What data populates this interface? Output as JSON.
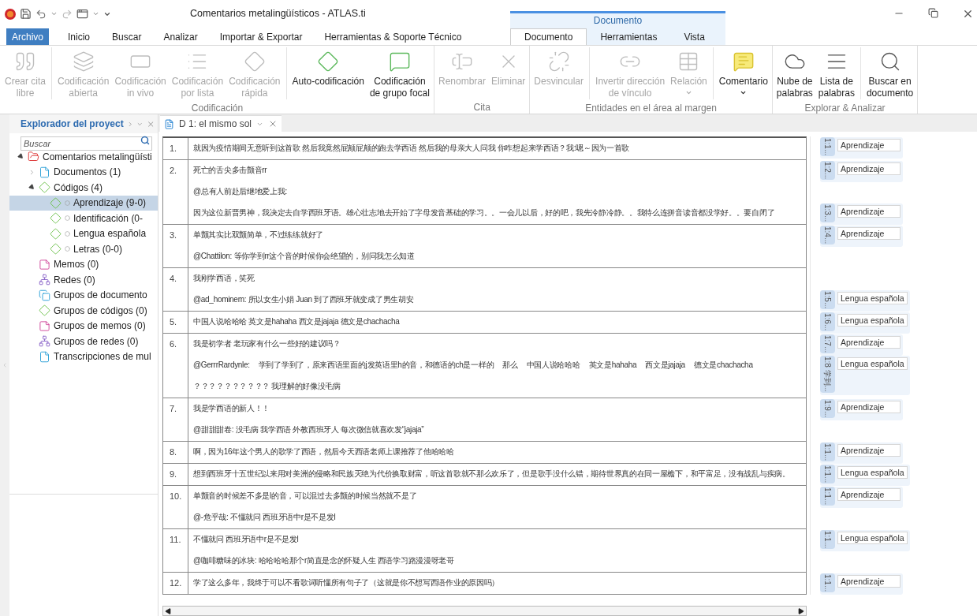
{
  "window": {
    "title": "Comentarios metalingüísticos - ATLAS.ti"
  },
  "menu_tabs": [
    {
      "label": "Archivo",
      "kind": "file",
      "selected": false
    },
    {
      "label": "Inicio",
      "kind": "main",
      "selected": false
    },
    {
      "label": "Buscar",
      "kind": "main",
      "selected": false
    },
    {
      "label": "Analizar",
      "kind": "main",
      "selected": false
    },
    {
      "label": "Importar & Exportar",
      "kind": "main",
      "selected": false
    },
    {
      "label": "Herramientas & Soporte Técnico",
      "kind": "main",
      "selected": false
    }
  ],
  "context_group": {
    "title": "Documento",
    "tabs": [
      {
        "label": "Documento",
        "selected": true
      },
      {
        "label": "Herramientas",
        "selected": false
      },
      {
        "label": "Vista",
        "selected": false
      }
    ]
  },
  "ribbon_groups": [
    {
      "caption": "Codificación",
      "sections": [
        [
          {
            "lines": [
              "Crear cita",
              "libre"
            ],
            "disabled": true
          }
        ],
        [
          {
            "lines": [
              "Codificación",
              "abierta"
            ],
            "disabled": true
          },
          {
            "lines": [
              "Codificación",
              "in vivo"
            ],
            "disabled": true
          },
          {
            "lines": [
              "Codificación",
              "por lista"
            ],
            "disabled": true
          },
          {
            "lines": [
              "Codificación",
              "rápida"
            ],
            "disabled": true
          }
        ],
        [
          {
            "lines": [
              "Auto-codificación"
            ],
            "disabled": false
          },
          {
            "lines": [
              "Codificación",
              "de grupo focal"
            ],
            "disabled": false
          }
        ]
      ]
    },
    {
      "caption": "Cita",
      "sections": [
        [
          {
            "lines": [
              "Renombrar"
            ],
            "disabled": true
          },
          {
            "lines": [
              "Eliminar"
            ],
            "disabled": true
          }
        ]
      ]
    },
    {
      "caption": "Entidades en el área al margen",
      "sections": [
        [
          {
            "lines": [
              "Desvincular"
            ],
            "disabled": true
          }
        ],
        [
          {
            "lines": [
              "Invertir dirección",
              "de vínculo"
            ],
            "disabled": true
          },
          {
            "lines": [
              "Relación"
            ],
            "disabled": true,
            "dropdown": true
          }
        ],
        [
          {
            "lines": [
              "Comentario"
            ],
            "disabled": false,
            "dropdown": true
          }
        ]
      ]
    },
    {
      "caption": "Explorar & Analizar",
      "sections": [
        [
          {
            "lines": [
              "Nube de",
              "palabras"
            ],
            "disabled": false
          },
          {
            "lines": [
              "Lista de",
              "palabras"
            ],
            "disabled": false
          }
        ],
        [
          {
            "lines": [
              "Buscar en",
              "documento"
            ],
            "disabled": false
          }
        ]
      ]
    }
  ],
  "explorer": {
    "title": "Explorador del proyect",
    "search": {
      "placeholder": "Buscar"
    },
    "tree": [
      {
        "label": "Comentarios metalingüísti",
        "kind": "project",
        "expanded": true,
        "selected": false,
        "children": [
          {
            "label": "Documentos (1)",
            "kind": "documents",
            "expanded": false,
            "selected": false
          },
          {
            "label": "Códigos (4)",
            "kind": "codes",
            "expanded": true,
            "selected": false,
            "children": [
              {
                "label": "Aprendizaje (9-0)",
                "kind": "code",
                "selected": true
              },
              {
                "label": "Identificación (0-",
                "kind": "code",
                "selected": false
              },
              {
                "label": "Lengua española",
                "kind": "code",
                "selected": false
              },
              {
                "label": "Letras (0-0)",
                "kind": "code",
                "selected": false
              }
            ]
          },
          {
            "label": "Memos (0)",
            "kind": "memos",
            "selected": false
          },
          {
            "label": "Redes (0)",
            "kind": "networks",
            "selected": false
          },
          {
            "label": "Grupos de documento",
            "kind": "document-groups",
            "selected": false
          },
          {
            "label": "Grupos de códigos (0)",
            "kind": "code-groups",
            "selected": false
          },
          {
            "label": "Grupos de memos (0)",
            "kind": "memo-groups",
            "selected": false
          },
          {
            "label": "Grupos de redes (0)",
            "kind": "network-groups",
            "selected": false
          },
          {
            "label": "Transcripciones de mul",
            "kind": "transcriptions",
            "selected": false
          }
        ]
      }
    ]
  },
  "document_tab": {
    "label": "D 1: el mismo sol"
  },
  "document_rows": [
    {
      "number": "1.",
      "paragraphs": [
        {
          "segments": [
            "就因为疫情期间无意听到这首歌 然后我竟然屁颠屁颠的跑去学西语 然后我的母亲大人问我 你咋想起来学西语？我:嗯～因为一首歌"
          ],
          "margin": {
            "quote": "1:1...",
            "code": "Aprendizaje"
          }
        }
      ]
    },
    {
      "number": "2.",
      "paragraphs": [
        {
          "segments": [
            "死亡的舌尖多击颤音rr"
          ],
          "margin": {
            "quote": "1:2...",
            "code": "Aprendizaje"
          }
        },
        {
          "segments": [
            "@总有人前赴后继地爱上我:"
          ]
        },
        {
          "segments": [
            "因为这位新晋男神，我决定去自学西班牙语。雄心壮志地去开始了字母发音基础的学习。。一会儿以后，好的吧，我先冷静冷静。。我特么连拼音读音都没学好。。要自闭了"
          ],
          "margin": {
            "quote": "1:3...",
            "code": "Aprendizaje"
          }
        }
      ]
    },
    {
      "number": "3.",
      "paragraphs": [
        {
          "segments": [
            "单颤其实比双颤简单，不过练练就好了"
          ],
          "margin": {
            "quote": "1:4...",
            "code": "Aprendizaje"
          }
        },
        {
          "segments": [
            "@Chattilon: 等你学到rr这个音的时候你会绝望的，别问我怎么知道"
          ]
        }
      ]
    },
    {
      "number": "4.",
      "paragraphs": [
        {
          "segments": [
            "我刚学西语，笑死"
          ]
        },
        {
          "segments": [
            "@ad_hominem: 所以女生小娟 Juan 到了西班牙就变成了男生胡安"
          ],
          "margin": {
            "quote": "1:5...",
            "code": "Lengua española"
          }
        }
      ]
    },
    {
      "number": "5.",
      "paragraphs": [
        {
          "segments": [
            "中国人说哈哈哈 英文是hahaha 西文是jajaja 德文是chachacha"
          ],
          "margin": {
            "quote": "1:6...",
            "code": "Lengua española"
          }
        }
      ]
    },
    {
      "number": "6.",
      "paragraphs": [
        {
          "segments": [
            "我是初学者 老玩家有什么一些好的建议吗？"
          ],
          "margin": {
            "quote": "1:7...",
            "code": "Aprendizaje"
          }
        },
        {
          "segments": [
            "@GerrrRardynle:",
            "学到了学到了，原来西语里面的j发英语里h的音，和德语的ch是一样的",
            "那么",
            "中国人说哈哈哈",
            "英文是hahaha",
            "西文是jajaja",
            "德文是chachacha"
          ],
          "margin": {
            "quote": "1:8 学到...",
            "code": "Lengua española"
          }
        },
        {
          "segments": [
            "？？？？？？？？？？ 我理解的好像没毛病"
          ]
        }
      ]
    },
    {
      "number": "7.",
      "paragraphs": [
        {
          "segments": [
            "我是学西语的新人！！"
          ],
          "margin": {
            "quote": "1:9...",
            "code": "Aprendizaje"
          }
        },
        {
          "segments": [
            "@甜甜甜卷: 没毛病 我学西语 外教西班牙人 每次微信就喜欢发“jajaja”"
          ]
        }
      ]
    },
    {
      "number": "8.",
      "paragraphs": [
        {
          "segments": [
            "啊，因为16年这个男人的歌学了西语，然后今天西语老师上课推荐了他哈哈哈"
          ],
          "margin": {
            "quote": "1:1...",
            "code": "Aprendizaje"
          }
        }
      ]
    },
    {
      "number": "9.",
      "paragraphs": [
        {
          "segments": [
            "想到西班牙十五世纪以来用对美洲的侵略和民族灭绝为代价换取财富，听这首歌就不那么欢乐了，但是歌手没什么错，期待世界真的在同一屋檐下，和平富足，没有战乱与疾病。"
          ],
          "margin": {
            "quote": "1:1...",
            "code": "Lengua española"
          }
        }
      ]
    },
    {
      "number": "10.",
      "paragraphs": [
        {
          "segments": [
            "单颤音的时候差不多是l的音，可以混过去多颤的时候当然就不是了"
          ],
          "margin": {
            "quote": "1:1...",
            "code": "Aprendizaje"
          }
        },
        {
          "segments": [
            "@-危乎哉: 不懂就问 西班牙语中r是不是发l"
          ]
        }
      ]
    },
    {
      "number": "11.",
      "paragraphs": [
        {
          "segments": [
            "不懂就问 西班牙语中r是不是发l"
          ],
          "margin": {
            "quote": "1:1...",
            "code": "Lengua española"
          }
        },
        {
          "segments": [
            "@咖啡糖味的冰块: 哈哈哈哈那个r简直是念的怀疑人生 西语学习路漫漫呀老哥"
          ]
        }
      ]
    },
    {
      "number": "12.",
      "paragraphs": [
        {
          "segments": [
            "学了这么多年，我终于可以不看歌词听懂所有句子了（这就是你不想写西语作业的原因吗）"
          ],
          "margin": {
            "quote": "1:1...",
            "code": "Aprendizaje"
          }
        }
      ]
    }
  ]
}
